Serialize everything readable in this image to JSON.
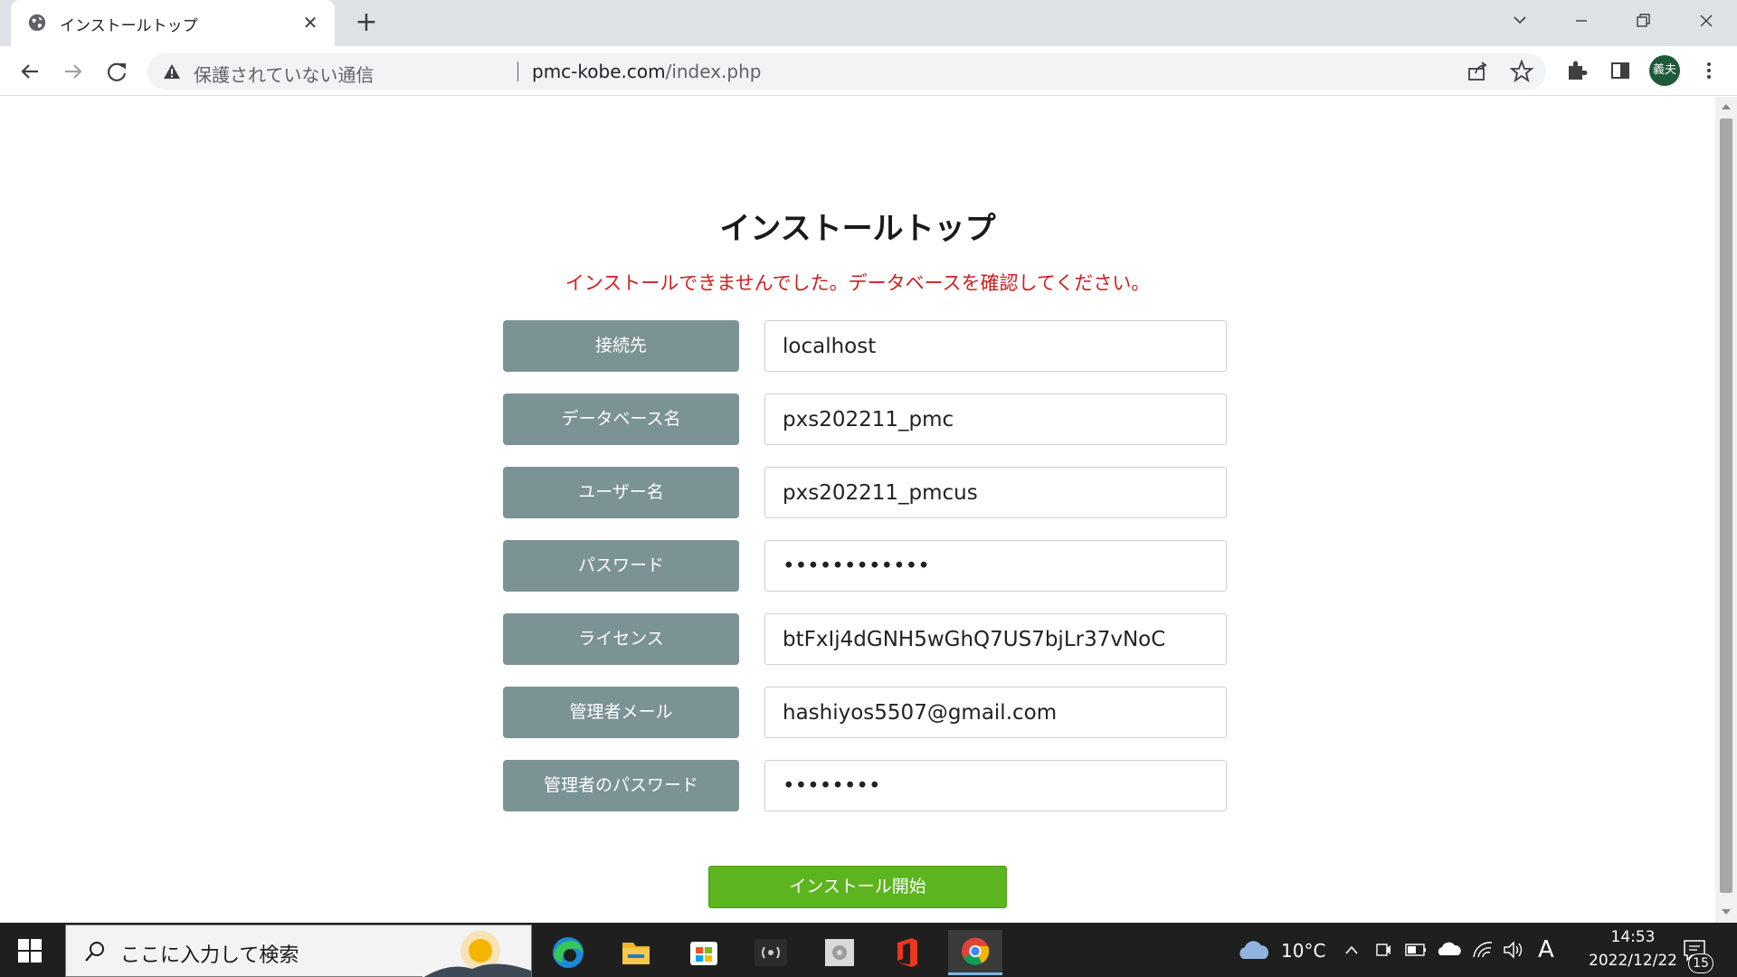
{
  "browser": {
    "tab_title": "インストールトップ",
    "security_label": "保護されていない通信",
    "url_host": "pmc-kobe.com",
    "url_path": "/index.php",
    "profile_initials": "義夫"
  },
  "page": {
    "title": "インストールトップ",
    "error_message": "インストールできませんでした。データベースを確認してください。",
    "fields": [
      {
        "label": "接続先",
        "value": "localhost",
        "type": "text"
      },
      {
        "label": "データベース名",
        "value": "pxs202211_pmc",
        "type": "text"
      },
      {
        "label": "ユーザー名",
        "value": "pxs202211_pmcus",
        "type": "text"
      },
      {
        "label": "パスワード",
        "value": "••••••••••••",
        "type": "password"
      },
      {
        "label": "ライセンス",
        "value": "btFxIj4dGNH5wGhQ7US7bjLr37vNoC",
        "type": "text"
      },
      {
        "label": "管理者メール",
        "value": "hashiyos5507@gmail.com",
        "type": "text"
      },
      {
        "label": "管理者のパスワード",
        "value": "••••••••",
        "type": "password"
      }
    ],
    "submit_label": "インストール開始"
  },
  "taskbar": {
    "search_placeholder": "ここに入力して検索",
    "weather_temp": "10°C",
    "ime_indicator": "A",
    "time": "14:53",
    "date": "2022/12/22",
    "notification_count": "15",
    "apps": [
      "edge-icon",
      "file-explorer-icon",
      "store-icon",
      "broadcast-app-icon",
      "disk-app-icon",
      "office-icon",
      "chrome-icon"
    ]
  },
  "colors": {
    "label_bg": "#7c9396",
    "error_text": "#cc1f1f",
    "submit_bg": "#5cb51e"
  }
}
